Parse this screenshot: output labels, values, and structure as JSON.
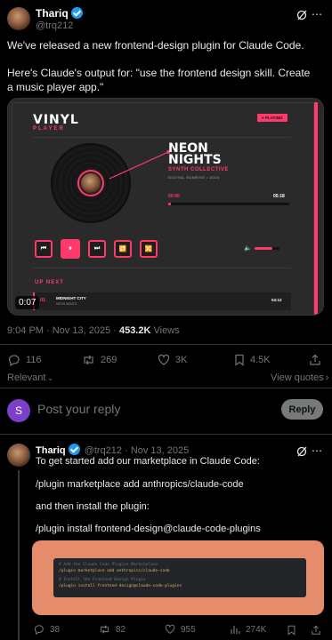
{
  "post": {
    "author_name": "Thariq",
    "handle": "@trq212",
    "text_line1": "We've released a new frontend-design plugin for Claude Code.",
    "text_line2": "Here's Claude's output for: \"use the frontend design skill. Create a music player app.\"",
    "timestamp": "9:04 PM · Nov 13, 2025 · ",
    "views_count": "453.2K",
    "views_label": " Views",
    "replies": "116",
    "reposts": "269",
    "likes": "3K",
    "bookmarks": "4.5K",
    "sort_label": "Relevant",
    "view_quotes": "View quotes"
  },
  "media": {
    "app_title": "VINYL",
    "app_subtitle": "PLAYER",
    "playing_badge": "● PLAYING",
    "track_title_1": "NEON",
    "track_title_2": "NIGHTS",
    "artist": "SYNTH COLLECTIVE",
    "album": "DIGITAL SUNRISE • 2024",
    "time_current": "00:00",
    "time_total": "05:18",
    "progress": 0.02,
    "volume": 0.7,
    "up_next_label": "UP NEXT",
    "next_index": "01",
    "next_title": "MIDNIGHT CITY",
    "next_artist": "NEON WAVES",
    "next_duration": "04:12",
    "video_time": "0:07",
    "controls": [
      "⏮",
      "⏸",
      "⏭",
      "🔁",
      "🔀"
    ]
  },
  "reply_box": {
    "avatar_letter": "S",
    "placeholder": "Post your reply",
    "button": "Reply",
    "avatar_color": "#7b3fc9"
  },
  "reply": {
    "author_name": "Thariq",
    "handle_date": "@trq212 · Nov 13, 2025",
    "line1": "To get started add our marketplace in Claude Code:",
    "line2": "/plugin marketplace add anthropics/claude-code",
    "line3": "and then install the plugin:",
    "line4": "/plugin install frontend-design@claude-code-plugins",
    "code_comment1": "# Add the Claude Code Plugins Marketplace",
    "code_cmd1": "/plugin marketplace add anthropics/claude-code",
    "code_comment2": "# Install the Frontend Design Plugin",
    "code_cmd2": "/plugin install frontend-design@claude-code-plugins",
    "replies": "38",
    "reposts": "82",
    "likes": "955",
    "views": "274K"
  },
  "colors": {
    "accent_pink": "#ff3a6b",
    "verified_blue": "#1d9bf0"
  }
}
